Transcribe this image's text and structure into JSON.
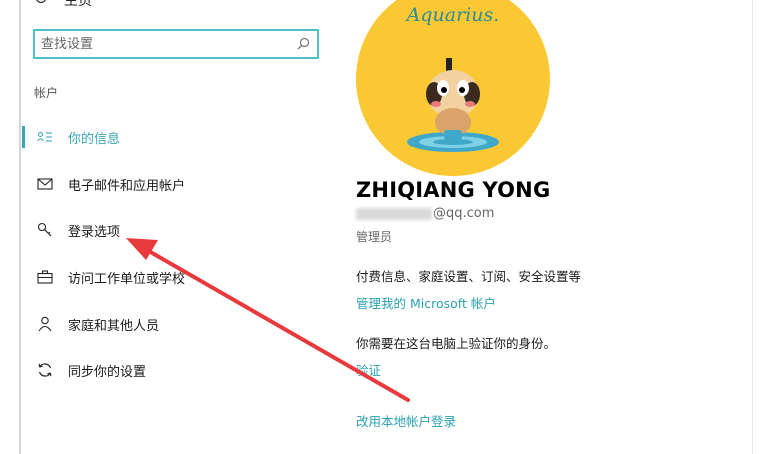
{
  "header": {
    "home_label": "主页"
  },
  "search": {
    "placeholder": "查找设置"
  },
  "sidebar": {
    "section_label": "帐户",
    "items": [
      {
        "label": "你的信息",
        "icon": "person-card-icon",
        "active": true
      },
      {
        "label": "电子邮件和应用帐户",
        "icon": "mail-icon",
        "active": false
      },
      {
        "label": "登录选项",
        "icon": "key-icon",
        "active": false
      },
      {
        "label": "访问工作单位或学校",
        "icon": "briefcase-icon",
        "active": false
      },
      {
        "label": "家庭和其他人员",
        "icon": "person-icon",
        "active": false
      },
      {
        "label": "同步你的设置",
        "icon": "sync-icon",
        "active": false
      }
    ]
  },
  "profile": {
    "avatar_text": "Aquarius.",
    "name": "ZHIQIANG YONG",
    "email_suffix": "@qq.com",
    "role": "管理员"
  },
  "account": {
    "billing_text": "付费信息、家庭设置、订阅、安全设置等",
    "manage_link": "管理我的 Microsoft 帐户",
    "verify_text": "你需要在这台电脑上验证你的身份。",
    "verify_link": "验证",
    "local_login_link": "改用本地帐户登录"
  },
  "colors": {
    "accent": "#3aa7b4",
    "avatar_bg": "#f9c833",
    "annotation_arrow": "#e8393c"
  }
}
